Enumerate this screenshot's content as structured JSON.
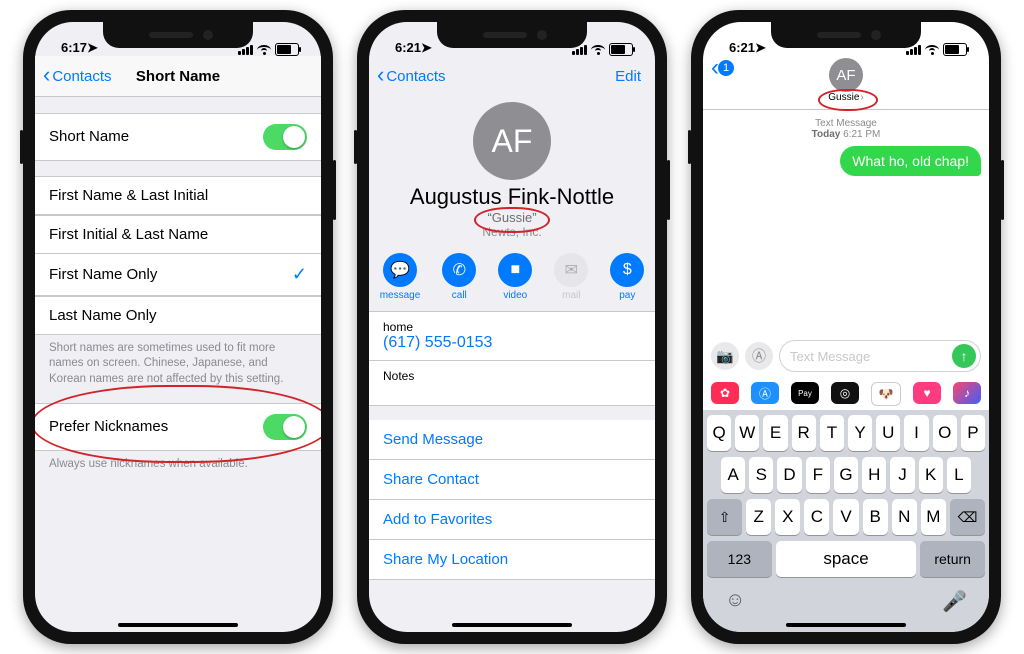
{
  "status": {
    "time1": "6:17",
    "time2": "6:21",
    "time3": "6:21"
  },
  "phone1": {
    "back": "Contacts",
    "title": "Short Name",
    "toggleLabel": "Short Name",
    "options": [
      "First Name & Last Initial",
      "First Initial & Last Name",
      "First Name Only",
      "Last Name Only"
    ],
    "selectedIndex": 2,
    "optionsFooter": "Short names are sometimes used to fit more names on screen. Chinese, Japanese, and Korean names are not affected by this setting.",
    "preferLabel": "Prefer Nicknames",
    "preferFooter": "Always use nicknames when available."
  },
  "phone2": {
    "back": "Contacts",
    "edit": "Edit",
    "initials": "AF",
    "name": "Augustus Fink-Nottle",
    "nickname": "“Gussie”",
    "company": "Newts, Inc.",
    "actions": {
      "message": "message",
      "call": "call",
      "video": "video",
      "mail": "mail",
      "pay": "pay"
    },
    "home": {
      "label": "home",
      "value": "(617) 555-0153"
    },
    "notes": "Notes",
    "links": [
      "Send Message",
      "Share Contact",
      "Add to Favorites",
      "Share My Location"
    ]
  },
  "phone3": {
    "backBadge": "1",
    "initials": "AF",
    "name": "Gussie",
    "tsLabel": "Text Message",
    "tsDay": "Today",
    "tsTime": "6:21 PM",
    "bubble": "What ho, old chap!",
    "placeholder": "Text Message",
    "rows": [
      [
        "Q",
        "W",
        "E",
        "R",
        "T",
        "Y",
        "U",
        "I",
        "O",
        "P"
      ],
      [
        "A",
        "S",
        "D",
        "F",
        "G",
        "H",
        "J",
        "K",
        "L"
      ],
      [
        "Z",
        "X",
        "C",
        "V",
        "B",
        "N",
        "M"
      ]
    ],
    "numKey": "123",
    "spaceKey": "space",
    "returnKey": "return"
  }
}
